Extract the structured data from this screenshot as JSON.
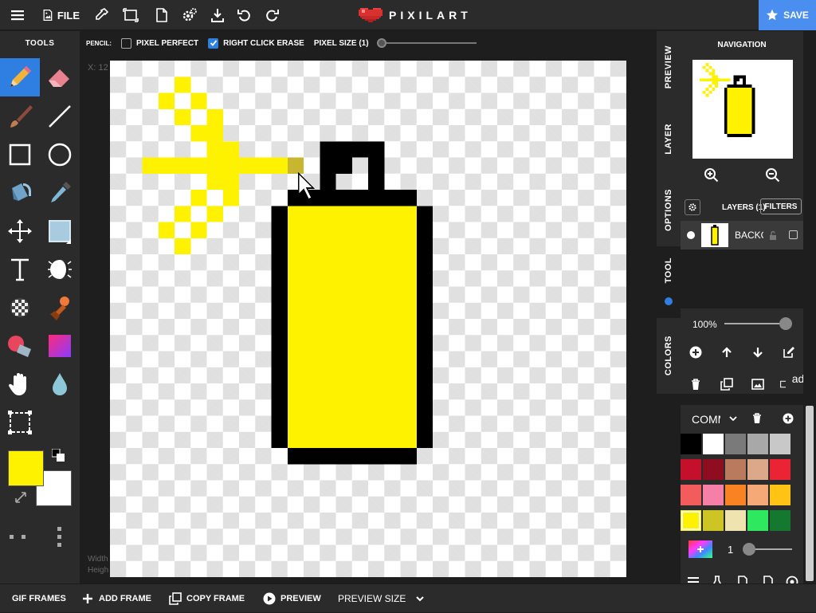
{
  "topbar": {
    "file_label": "FILE",
    "brand": "PIXILART",
    "save_label": "SAVE",
    "icons": [
      "menu-icon",
      "file-image-icon",
      "eyedropper-icon",
      "resize-icon",
      "new-file-icon",
      "settings-icon",
      "download-icon",
      "undo-icon",
      "redo-icon"
    ]
  },
  "tools": {
    "title": "TOOLS",
    "items": [
      "pencil",
      "eraser",
      "brush",
      "line",
      "rectangle",
      "circle",
      "bucket",
      "eyedropper",
      "move",
      "selection",
      "text",
      "shading",
      "dither",
      "stamp",
      "color-replace",
      "gradient",
      "pan",
      "drop",
      "crop"
    ],
    "primary_color": "#fff200",
    "secondary_color": "#ffffff"
  },
  "options": {
    "pencil_label": "PENCIL:",
    "pixel_perfect_label": "PIXEL PERFECT",
    "pixel_perfect_checked": false,
    "right_click_erase_label": "RIGHT CLICK ERASE",
    "right_click_erase_checked": true,
    "pixel_size_label": "PIXEL SIZE (1)",
    "pixel_size": 1
  },
  "workspace": {
    "coord_text": "X: 12",
    "dims_width": "Width",
    "dims_height": "Heigh"
  },
  "sidetabs": {
    "preview": "PREVIEW",
    "layer": "LAYER",
    "options": "OPTIONS",
    "tool": "TOOL",
    "colors": "COLORS"
  },
  "navigation": {
    "title": "NAVIGATION"
  },
  "layers": {
    "title": "LAYERS (1)",
    "filters_label": "FILTERS",
    "layer_name": "BACKGROUND",
    "opacity": "100%"
  },
  "ads_label": "ads",
  "palette": {
    "name": "COMMON",
    "swatches": [
      [
        "#000000",
        "#ffffff",
        "#7a7a7a",
        "#a8a8a8",
        "#c8c8c8"
      ],
      [
        "#c5102b",
        "#8e0d1e",
        "#b97a5e",
        "#dba88a",
        "#ea2335"
      ],
      [
        "#f25c5c",
        "#f57fa6",
        "#f98222",
        "#f4a977",
        "#ffc315"
      ],
      [
        "#fff200",
        "#cdc426",
        "#efe3b0",
        "#2ee860",
        "#14782e"
      ]
    ],
    "brush_size": "1"
  },
  "bottombar": {
    "gif_frames": "GIF FRAMES",
    "add_frame": "ADD FRAME",
    "copy_frame": "COPY FRAME",
    "preview": "PREVIEW",
    "preview_size": "PREVIEW SIZE"
  }
}
